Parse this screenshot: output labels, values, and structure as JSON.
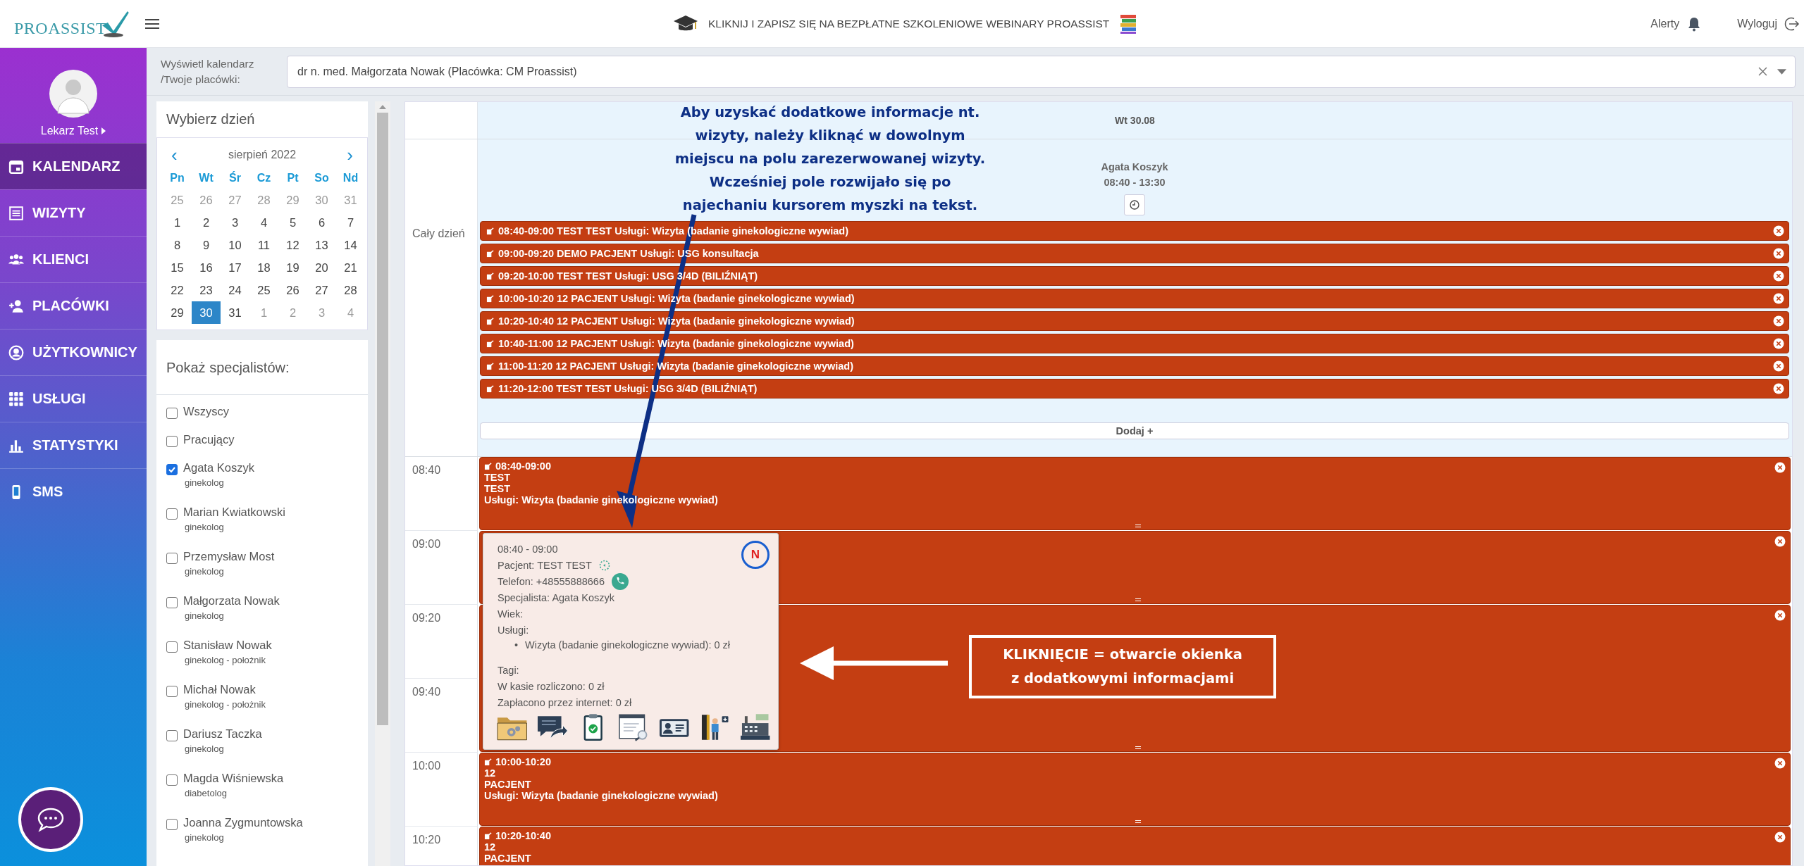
{
  "topbar": {
    "logo": "PROASSIST",
    "banner": "KLIKNIJ I ZAPISZ SIĘ NA BEZPŁATNE SZKOLENIOWE WEBINARY PROASSIST",
    "alerts": "Alerty",
    "logout": "Wyloguj"
  },
  "sidebar": {
    "user": "Lekarz Test",
    "items": [
      {
        "label": "KALENDARZ",
        "selected": true
      },
      {
        "label": "WIZYTY",
        "selected": false
      },
      {
        "label": "KLIENCI",
        "selected": false
      },
      {
        "label": "PLACÓWKI",
        "selected": false
      },
      {
        "label": "UŻYTKOWNICY",
        "selected": false
      },
      {
        "label": "USŁUGI",
        "selected": false
      },
      {
        "label": "STATYSTYKI",
        "selected": false
      },
      {
        "label": "SMS",
        "selected": false
      }
    ]
  },
  "filter": {
    "label": "Wyświetl kalendarz /Twoje placówki:",
    "value": "dr n. med. Małgorzata Nowak (Placówka: CM Proassist)"
  },
  "day_picker": {
    "title": "Wybierz dzień",
    "month": "sierpień 2022",
    "prev": "‹",
    "next": "›",
    "weekdays": [
      "Pn",
      "Wt",
      "Śr",
      "Cz",
      "Pt",
      "So",
      "Nd"
    ],
    "days": [
      {
        "label": "25",
        "muted": true,
        "selected": false
      },
      {
        "label": "26",
        "muted": true,
        "selected": false
      },
      {
        "label": "27",
        "muted": true,
        "selected": false
      },
      {
        "label": "28",
        "muted": true,
        "selected": false
      },
      {
        "label": "29",
        "muted": true,
        "selected": false
      },
      {
        "label": "30",
        "muted": true,
        "selected": false
      },
      {
        "label": "31",
        "muted": true,
        "selected": false
      },
      {
        "label": "1",
        "muted": false,
        "selected": false
      },
      {
        "label": "2",
        "muted": false,
        "selected": false
      },
      {
        "label": "3",
        "muted": false,
        "selected": false
      },
      {
        "label": "4",
        "muted": false,
        "selected": false
      },
      {
        "label": "5",
        "muted": false,
        "selected": false
      },
      {
        "label": "6",
        "muted": false,
        "selected": false
      },
      {
        "label": "7",
        "muted": false,
        "selected": false
      },
      {
        "label": "8",
        "muted": false,
        "selected": false
      },
      {
        "label": "9",
        "muted": false,
        "selected": false
      },
      {
        "label": "10",
        "muted": false,
        "selected": false
      },
      {
        "label": "11",
        "muted": false,
        "selected": false
      },
      {
        "label": "12",
        "muted": false,
        "selected": false
      },
      {
        "label": "13",
        "muted": false,
        "selected": false
      },
      {
        "label": "14",
        "muted": false,
        "selected": false
      },
      {
        "label": "15",
        "muted": false,
        "selected": false
      },
      {
        "label": "16",
        "muted": false,
        "selected": false
      },
      {
        "label": "17",
        "muted": false,
        "selected": false
      },
      {
        "label": "18",
        "muted": false,
        "selected": false
      },
      {
        "label": "19",
        "muted": false,
        "selected": false
      },
      {
        "label": "20",
        "muted": false,
        "selected": false
      },
      {
        "label": "21",
        "muted": false,
        "selected": false
      },
      {
        "label": "22",
        "muted": false,
        "selected": false
      },
      {
        "label": "23",
        "muted": false,
        "selected": false
      },
      {
        "label": "24",
        "muted": false,
        "selected": false
      },
      {
        "label": "25",
        "muted": false,
        "selected": false
      },
      {
        "label": "26",
        "muted": false,
        "selected": false
      },
      {
        "label": "27",
        "muted": false,
        "selected": false
      },
      {
        "label": "28",
        "muted": false,
        "selected": false
      },
      {
        "label": "29",
        "muted": false,
        "selected": false
      },
      {
        "label": "30",
        "muted": false,
        "selected": true
      },
      {
        "label": "31",
        "muted": false,
        "selected": false
      },
      {
        "label": "1",
        "muted": true,
        "selected": false
      },
      {
        "label": "2",
        "muted": true,
        "selected": false
      },
      {
        "label": "3",
        "muted": true,
        "selected": false
      },
      {
        "label": "4",
        "muted": true,
        "selected": false
      }
    ]
  },
  "specialists": {
    "title": "Pokaż specjalistów:",
    "items": [
      {
        "name": "Wszyscy",
        "checked": false
      },
      {
        "name": "Pracujący",
        "checked": false
      },
      {
        "name": "Agata Koszyk",
        "role": "ginekolog",
        "checked": true
      },
      {
        "name": "Marian Kwiatkowski",
        "role": "ginekolog",
        "checked": false
      },
      {
        "name": "Przemysław Most",
        "role": "ginekolog",
        "checked": false
      },
      {
        "name": "Małgorzata Nowak",
        "role": "ginekolog",
        "checked": false
      },
      {
        "name": "Stanisław Nowak",
        "role": "ginekolog - położnik",
        "checked": false
      },
      {
        "name": "Michał Nowak",
        "role": "ginekolog - położnik",
        "checked": false
      },
      {
        "name": "Dariusz Taczka",
        "role": "ginekolog",
        "checked": false
      },
      {
        "name": "Magda Wiśniewska",
        "role": "diabetolog",
        "checked": false
      },
      {
        "name": "Joanna Zygmuntowska",
        "role": "ginekolog",
        "checked": false
      }
    ]
  },
  "calendar": {
    "day": "Wt 30.08",
    "all_day_label": "Cały dzień",
    "specialist": "Agata Koszyk",
    "hours": "08:40 - 13:30",
    "all_day_events": [
      {
        "text": "08:40-09:00 TEST TEST Usługi: Wizyta (badanie ginekologiczne wywiad)"
      },
      {
        "text": "09:00-09:20 DEMO PACJENT Usługi: USG konsultacja"
      },
      {
        "text": "09:20-10:00 TEST TEST Usługi: USG 3/4D (BILIŹNIĄT)"
      },
      {
        "text": "10:00-10:20 12 PACJENT Usługi: Wizyta (badanie ginekologiczne wywiad)"
      },
      {
        "text": "10:20-10:40 12 PACJENT Usługi: Wizyta (badanie ginekologiczne wywiad)"
      },
      {
        "text": "10:40-11:00 12 PACJENT Usługi: Wizyta (badanie ginekologiczne wywiad)"
      },
      {
        "text": "11:00-11:20 12 PACJENT Usługi: Wizyta (badanie ginekologiczne wywiad)"
      },
      {
        "text": "11:20-12:00 TEST TEST Usługi: USG 3/4D (BILIŹNIĄT)"
      }
    ],
    "add_button": "Dodaj +",
    "times": [
      "08:40",
      "09:00",
      "09:20",
      "09:40",
      "10:00",
      "10:20"
    ],
    "events": [
      {
        "kind": "short",
        "time": "08:40-09:00",
        "lines": [
          "TEST",
          "TEST"
        ],
        "services": "Usługi: Wizyta (badanie ginekologiczne wywiad)"
      },
      {
        "kind": "short"
      },
      {
        "kind": "long"
      },
      {
        "kind": "short",
        "time": "10:00-10:20",
        "lines": [
          "12",
          "PACJENT"
        ],
        "services": "Usługi: Wizyta (badanie ginekologiczne wywiad)"
      },
      {
        "kind": "short",
        "time": "10:20-10:40",
        "lines": [
          "12",
          "PACJENT"
        ]
      }
    ]
  },
  "popup": {
    "time": "08:40 - 09:00",
    "patient": "Pacjent: TEST TEST",
    "phone": "Telefon: +48555888666",
    "specialist": "Specjalista: Agata Koszyk",
    "age": "Wiek:",
    "services_label": "Usługi:",
    "services": [
      {
        "bullet": "•",
        "text": "Wizyta (badanie ginekologiczne wywiad): 0 zł"
      }
    ],
    "tags": "Tagi:",
    "cash": "W kasie rozliczono: 0 zł",
    "online": "Zapłacono przez internet: 0 zł",
    "badge": "N"
  },
  "annotations": {
    "hint_lines": [
      "Aby uzyskać dodatkowe informacje nt.",
      "wizyty, należy kliknąć w dowolnym",
      "miejscu na polu zarezerwowanej wizyty.",
      "Wcześniej pole rozwijało się po",
      "najechaniu kursorem myszki na tekst."
    ],
    "callout_lines": [
      "KLIKNIĘCIE = otwarcie okienka",
      "z dodatkowymi informacjami"
    ]
  }
}
